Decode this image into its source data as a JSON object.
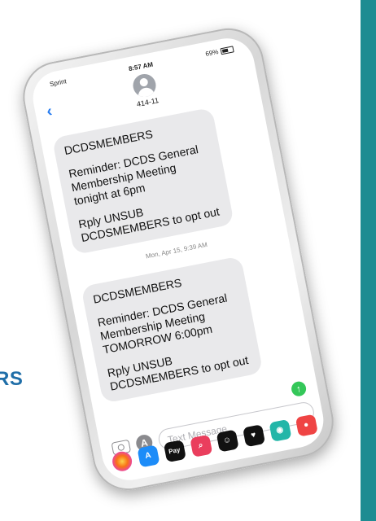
{
  "status_bar": {
    "carrier": "Sprint",
    "time": "8:57 AM",
    "battery": "69%"
  },
  "header": {
    "contact": "414-11"
  },
  "messages": [
    {
      "sender": "DCDSMEMBERS",
      "body": "Reminder: DCDS General Membership Meeting tonight at 6pm",
      "opt_out": "Rply UNSUB DCDSMEMBERS to opt out"
    },
    {
      "sender": "DCDSMEMBERS",
      "body": "Reminder: DCDS General Membership Meeting TOMORROW 6:00pm",
      "opt_out": "Rply UNSUB DCDSMEMBERS to opt out"
    }
  ],
  "timestamp": "Mon, Apr 15, 9:39 AM",
  "composer": {
    "placeholder": "Text Message"
  },
  "page_edge_text": "RS",
  "colors": {
    "accent_bar": "#1e8c92",
    "edge_text": "#1f6ea8",
    "bubble": "#e9e9eb",
    "ios_blue": "#2a7ef0"
  }
}
